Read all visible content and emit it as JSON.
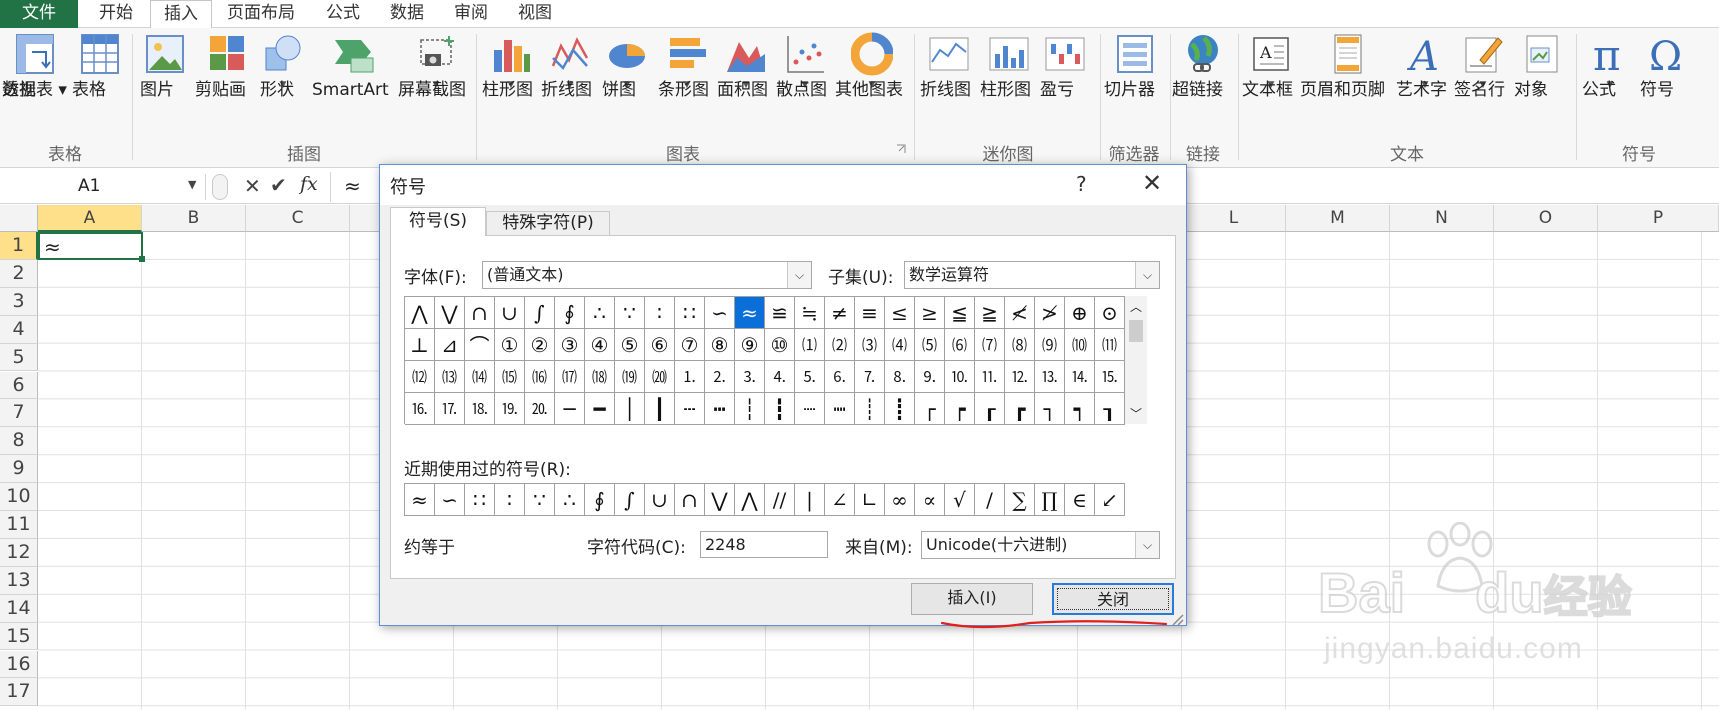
{
  "menu": {
    "tabs": [
      "文件",
      "开始",
      "插入",
      "页面布局",
      "公式",
      "数据",
      "审阅",
      "视图"
    ],
    "active": "插入"
  },
  "ribbon": {
    "groups": {
      "table": "表格",
      "illustrations": "插图",
      "charts": "图表",
      "sparklines": "迷你图",
      "filters": "筛选器",
      "links": "链接",
      "text": "文本",
      "symbols": "符号"
    },
    "buttons": {
      "pivot_line1": "数据",
      "pivot_line2": "透视表",
      "table": "表格",
      "picture": "图片",
      "clipart": "剪贴画",
      "shapes": "形状",
      "smartart": "SmartArt",
      "screenshot": "屏幕截图",
      "column_chart": "柱形图",
      "line_chart": "折线图",
      "pie_chart": "饼图",
      "bar_chart": "条形图",
      "area_chart": "面积图",
      "scatter_chart": "散点图",
      "other_charts": "其他图表",
      "spark_line": "折线图",
      "spark_column": "柱形图",
      "spark_winloss": "盈亏",
      "slicer": "切片器",
      "hyperlink": "超链接",
      "textbox": "文本框",
      "header_footer": "页眉和页脚",
      "wordart": "艺术字",
      "signature": "签名行",
      "object": "对象",
      "equation": "公式",
      "symbol": "符号"
    }
  },
  "formula_bar": {
    "name_box": "A1",
    "fx_label": "fx",
    "content": "≈"
  },
  "sheet": {
    "columns": [
      "A",
      "B",
      "C",
      "L",
      "M",
      "N",
      "O",
      "P"
    ],
    "rows": [
      "1",
      "2",
      "3",
      "4",
      "5",
      "6",
      "7",
      "8",
      "9",
      "10",
      "11",
      "12",
      "13",
      "14",
      "15",
      "16",
      "17"
    ],
    "a1_value": "≈"
  },
  "dialog": {
    "title": "符号",
    "help": "?",
    "close": "✕",
    "tab_symbols": "符号(S)",
    "tab_special": "特殊字符(P)",
    "font_label": "字体(F):",
    "font_value": "(普通文本)",
    "subset_label": "子集(U):",
    "subset_value": "数学运算符",
    "grid": [
      [
        "⋀",
        "⋁",
        "∩",
        "∪",
        "∫",
        "∮",
        "∴",
        "∵",
        "∶",
        "∷",
        "∽",
        "≈",
        "≌",
        "≒",
        "≠",
        "≡",
        "≤",
        "≥",
        "≦",
        "≧",
        "≮",
        "≯",
        "⊕",
        "⊙"
      ],
      [
        "⊥",
        "⊿",
        "⌒",
        "①",
        "②",
        "③",
        "④",
        "⑤",
        "⑥",
        "⑦",
        "⑧",
        "⑨",
        "⑩",
        "⑴",
        "⑵",
        "⑶",
        "⑷",
        "⑸",
        "⑹",
        "⑺",
        "⑻",
        "⑼",
        "⑽",
        "⑾"
      ],
      [
        "⑿",
        "⒀",
        "⒁",
        "⒂",
        "⒃",
        "⒄",
        "⒅",
        "⒆",
        "⒇",
        "⒈",
        "⒉",
        "⒊",
        "⒋",
        "⒌",
        "⒍",
        "⒎",
        "⒏",
        "⒐",
        "⒑",
        "⒒",
        "⒓",
        "⒔",
        "⒕",
        "⒖"
      ],
      [
        "⒗",
        "⒘",
        "⒙",
        "⒚",
        "⒛",
        "─",
        "━",
        "│",
        "┃",
        "┄",
        "┅",
        "┆",
        "┇",
        "┈",
        "┉",
        "┊",
        "┋",
        "┌",
        "┍",
        "┎",
        "┏",
        "┐",
        "┑",
        "┒"
      ]
    ],
    "selected_symbol": "≈",
    "recent_label": "近期使用过的符号(R):",
    "recent": [
      "≈",
      "∽",
      "∷",
      "∶",
      "∵",
      "∴",
      "∮",
      "∫",
      "∪",
      "∩",
      "⋁",
      "⋀",
      "//",
      "|",
      "∠",
      "∟",
      "∞",
      "∝",
      "√",
      "/",
      "∑",
      "∏",
      "∈",
      "↙"
    ],
    "char_name": "约等于",
    "code_label": "字符代码(C):",
    "code_value": "2248",
    "from_label": "来自(M):",
    "from_value": "Unicode(十六进制)",
    "insert_button": "插入(I)",
    "close_button": "关闭"
  },
  "watermark": {
    "line1": "Bai",
    "line1b": "du",
    "line1c": "经验",
    "line2": "jingyan.baidu.com"
  },
  "colors": {
    "excel_green": "#217346",
    "selection_blue": "#0a6fd8",
    "annotation_red": "#e0201b"
  }
}
